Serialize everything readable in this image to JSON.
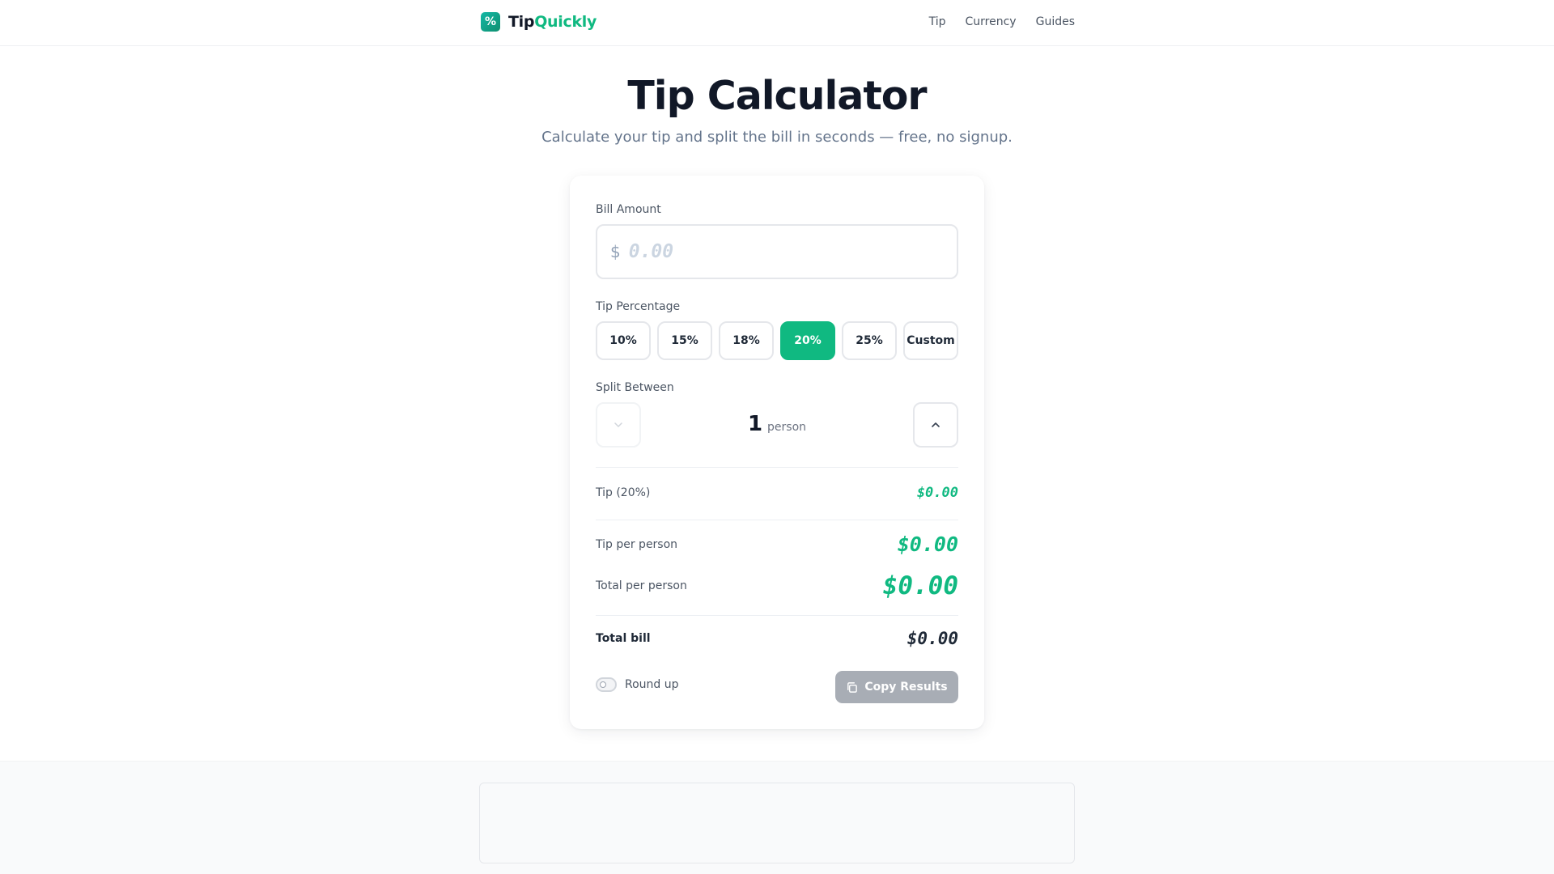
{
  "header": {
    "logo_symbol": "%",
    "logo_part1": "Tip",
    "logo_part2": "Quickly",
    "nav": [
      "Tip",
      "Currency",
      "Guides"
    ]
  },
  "hero": {
    "title": "Tip Calculator",
    "subtitle": "Calculate your tip and split the bill in seconds — free, no signup."
  },
  "form": {
    "bill_label": "Bill Amount",
    "currency_symbol": "$",
    "bill_placeholder": "0.00",
    "bill_value": "",
    "tip_label": "Tip Percentage",
    "tip_options": [
      "10%",
      "15%",
      "18%",
      "20%",
      "25%",
      "Custom"
    ],
    "tip_selected": "20%",
    "split_label": "Split Between",
    "split_count": "1",
    "split_unit": "person"
  },
  "results": {
    "tip_label": "Tip (20%)",
    "tip_value": "$0.00",
    "tip_per_person_label": "Tip per person",
    "tip_per_person_value": "$0.00",
    "total_per_person_label": "Total per person",
    "total_per_person_value": "$0.00",
    "total_bill_label": "Total bill",
    "total_bill_value": "$0.00"
  },
  "actions": {
    "round_up_label": "Round up",
    "round_up_on": false,
    "copy_label": "Copy Results"
  },
  "colors": {
    "accent": "#10b981",
    "text": "#111827",
    "muted": "#64748b",
    "disabled_button": "#a8adb5"
  },
  "icons": {
    "decrement": "chevron-down-icon",
    "increment": "chevron-up-icon",
    "copy": "copy-icon"
  }
}
